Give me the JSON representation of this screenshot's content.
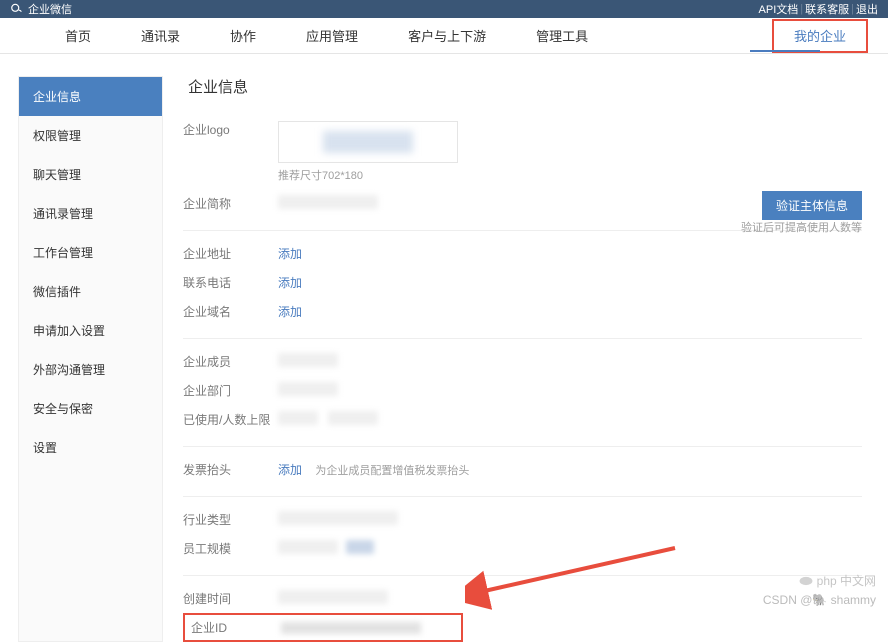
{
  "header": {
    "brand": "企业微信",
    "links": {
      "api": "API文档",
      "support": "联系客服",
      "logout": "退出"
    }
  },
  "nav": [
    "首页",
    "通讯录",
    "协作",
    "应用管理",
    "客户与上下游",
    "管理工具",
    "我的企业"
  ],
  "sidebar": {
    "items": [
      "企业信息",
      "权限管理",
      "聊天管理",
      "通讯录管理",
      "工作台管理",
      "微信插件",
      "申请加入设置",
      "外部沟通管理",
      "安全与保密",
      "设置"
    ]
  },
  "content": {
    "title": "企业信息",
    "logo_label": "企业logo",
    "logo_hint": "推荐尺寸702*180",
    "name_label": "企业简称",
    "verify_btn": "验证主体信息",
    "verify_hint": "验证后可提高使用人数等",
    "addr_label": "企业地址",
    "phone_label": "联系电话",
    "domain_label": "企业域名",
    "add": "添加",
    "members_label": "企业成员",
    "dept_label": "企业部门",
    "used_label": "已使用/人数上限",
    "invoice_label": "发票抬头",
    "invoice_hint": "为企业成员配置增值税发票抬头",
    "industry_label": "行业类型",
    "scale_label": "员工规模",
    "createtime_label": "创建时间",
    "corpid_label": "企业ID"
  },
  "watermark": {
    "php": "php 中文网",
    "csdn": "CSDN @🐘 shammy"
  }
}
